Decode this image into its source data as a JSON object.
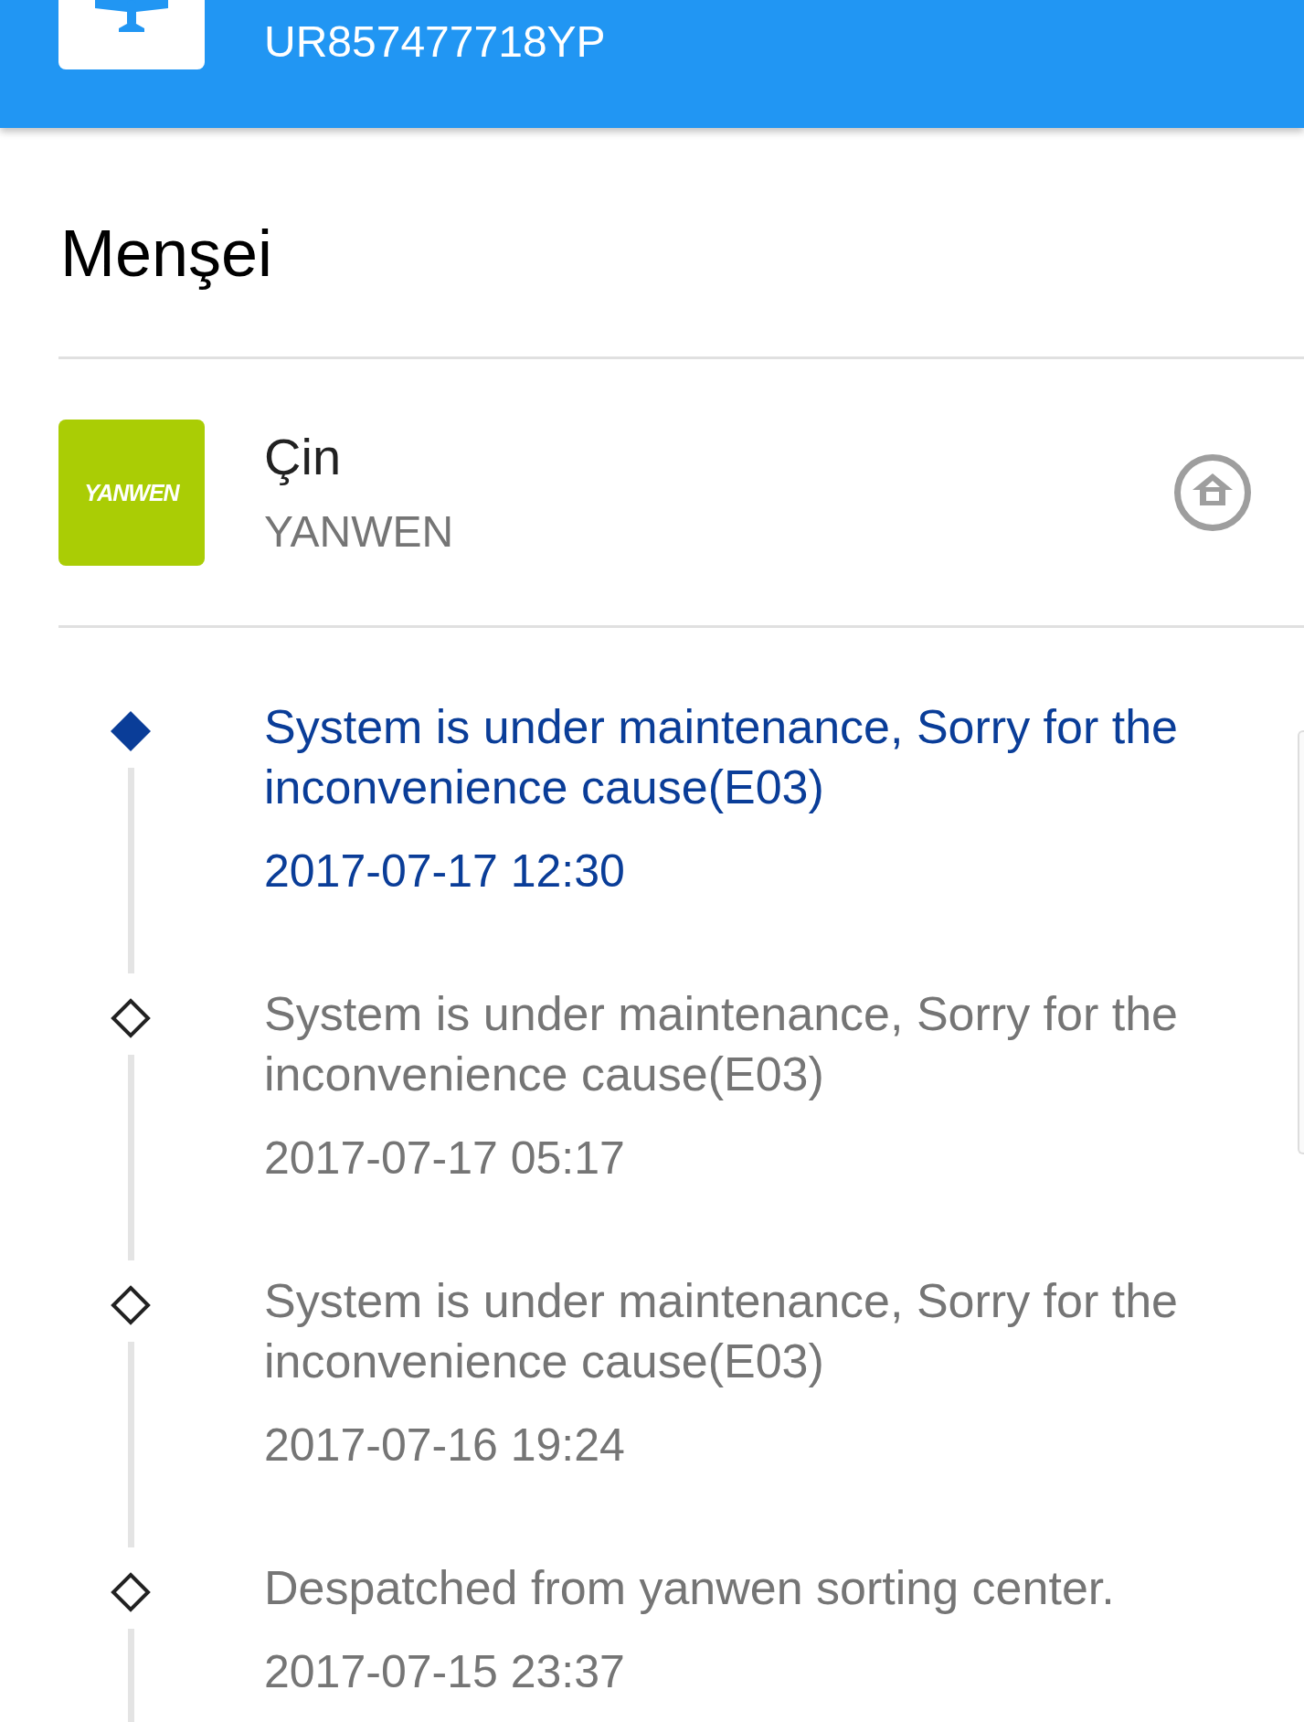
{
  "header": {
    "tracking_number": "UR857477718YP"
  },
  "origin": {
    "heading": "Menşei",
    "logo_text": "YANWEN",
    "country": "Çin",
    "carrier": "YANWEN"
  },
  "events": [
    {
      "description": "System is under maintenance, Sorry for the inconvenience cause(E03)",
      "time": "2017-07-17 12:30",
      "current": true
    },
    {
      "description": "System is under maintenance, Sorry for the inconvenience cause(E03)",
      "time": "2017-07-17 05:17",
      "current": false
    },
    {
      "description": "System is under maintenance, Sorry for the inconvenience cause(E03)",
      "time": "2017-07-16 19:24",
      "current": false
    },
    {
      "description": "Despatched from yanwen sorting center.",
      "time": "2017-07-15 23:37",
      "current": false
    }
  ]
}
